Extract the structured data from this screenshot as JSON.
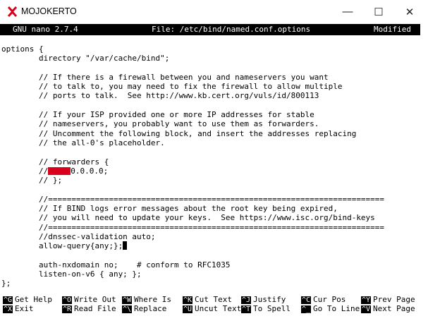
{
  "window": {
    "title": "MOJOKERTO",
    "minimize_glyph": "—",
    "maximize_glyph": "☐",
    "close_glyph": "✕",
    "icon": "x-app-icon",
    "icon_color": "#d9001b"
  },
  "nano": {
    "version": "GNU nano 2.7.4",
    "file_label": "File: /etc/bind/named.conf.options",
    "status": "Modified"
  },
  "editor": {
    "lines": [
      "options {",
      "        directory \"/var/cache/bind\";",
      "",
      "        // If there is a firewall between you and nameservers you want",
      "        // to talk to, you may need to fix the firewall to allow multiple",
      "        // ports to talk.  See http://www.kb.cert.org/vuls/id/800113",
      "",
      "        // If your ISP provided one or more IP addresses for stable",
      "        // nameservers, you probably want to use them as forwarders.",
      "        // Uncomment the following block, and insert the addresses replacing",
      "        // the all-0's placeholder.",
      "",
      "        // forwarders {",
      "        //",
      "        // };",
      "",
      "        //========================================================================",
      "        // If BIND logs error messages about the root key being expired,",
      "        // you will need to update your keys.  See https://www.isc.org/bind-keys",
      "        //========================================================================",
      "        //dnssec-validation auto;",
      "        allow-query{any;};",
      "",
      "        auth-nxdomain no;    # conform to RFC1035",
      "        listen-on-v6 { any; };",
      "};"
    ],
    "forwarder_ip_suffix": "0.0.0.0;",
    "redaction_color": "#d9001b"
  },
  "shortcuts": {
    "row1": [
      {
        "key": "^G",
        "label": "Get Help"
      },
      {
        "key": "^O",
        "label": "Write Out"
      },
      {
        "key": "^W",
        "label": "Where Is"
      },
      {
        "key": "^K",
        "label": "Cut Text"
      },
      {
        "key": "^J",
        "label": "Justify"
      },
      {
        "key": "^C",
        "label": "Cur Pos"
      },
      {
        "key": "^Y",
        "label": "Prev Page"
      }
    ],
    "row2": [
      {
        "key": "^X",
        "label": "Exit"
      },
      {
        "key": "^R",
        "label": "Read File"
      },
      {
        "key": "^\\",
        "label": "Replace"
      },
      {
        "key": "^U",
        "label": "Uncut Text"
      },
      {
        "key": "^T",
        "label": "To Spell"
      },
      {
        "key": "^_",
        "label": "Go To Line"
      },
      {
        "key": "^V",
        "label": "Next Page"
      }
    ]
  }
}
